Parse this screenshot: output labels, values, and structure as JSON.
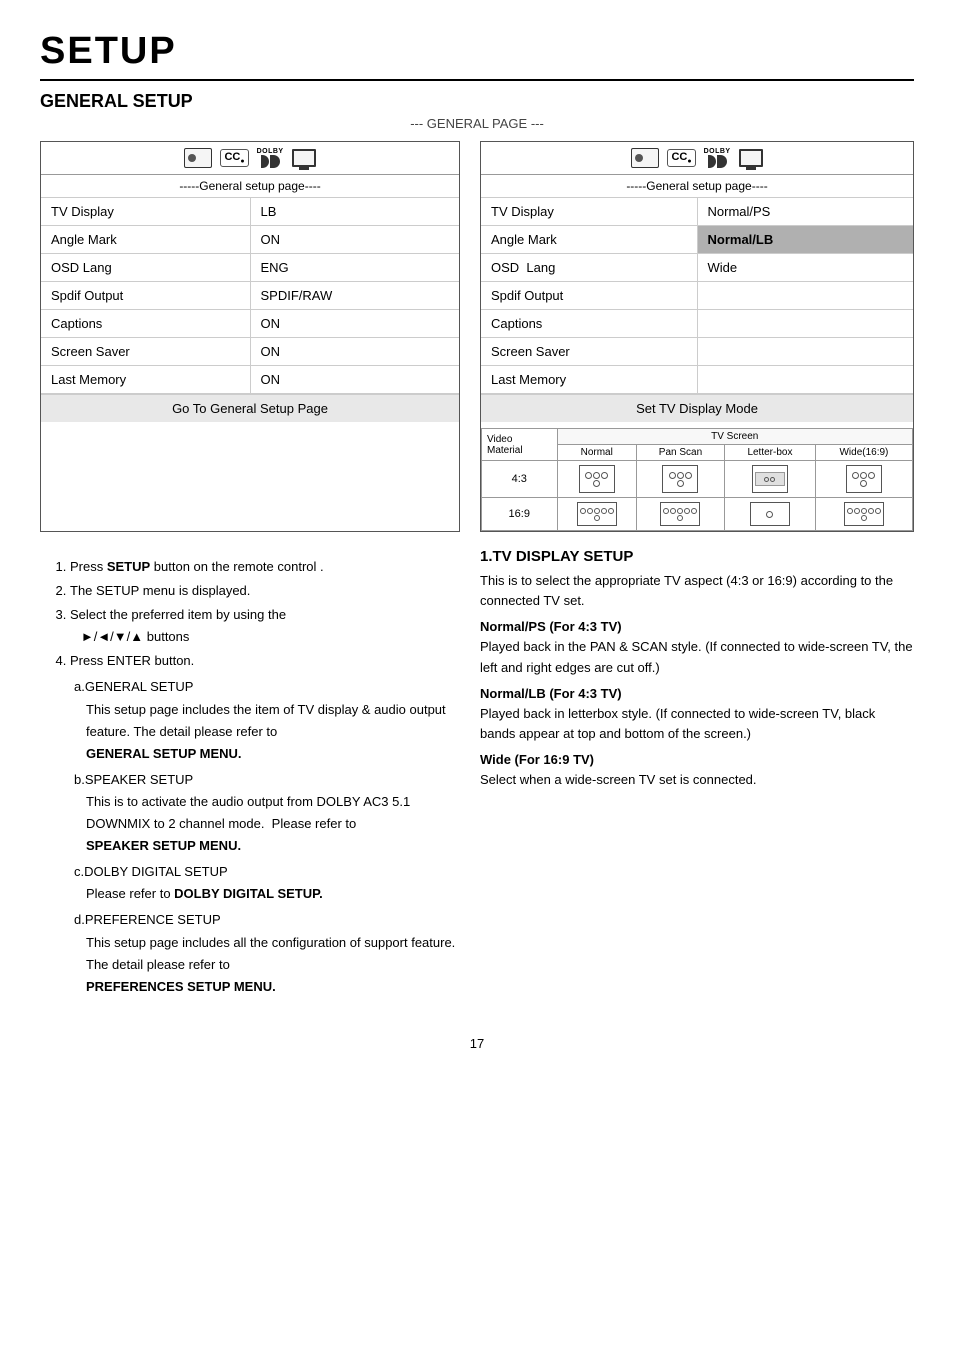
{
  "page": {
    "title": "SETUP",
    "section1_title": "GENERAL SETUP",
    "sub_heading": "--- GENERAL PAGE ---",
    "page_number": "17"
  },
  "panel_left": {
    "subtitle": "-----General setup page----",
    "rows": [
      {
        "label": "TV Display",
        "value": "LB"
      },
      {
        "label": "Angle Mark",
        "value": "ON"
      },
      {
        "label": "OSD Lang",
        "value": "ENG"
      },
      {
        "label": "Spdif Output",
        "value": "SPDIF/RAW"
      },
      {
        "label": "Captions",
        "value": "ON"
      },
      {
        "label": "Screen Saver",
        "value": "ON"
      },
      {
        "label": "Last Memory",
        "value": "ON"
      }
    ],
    "footer": "Go To General Setup Page"
  },
  "panel_right": {
    "subtitle": "-----General setup page----",
    "rows": [
      {
        "label": "TV Display",
        "value": "Normal/PS",
        "highlighted": false
      },
      {
        "label": "Angle Mark",
        "value": "Normal/LB",
        "highlighted": true
      },
      {
        "label": "OSD  Lang",
        "value": "Wide",
        "highlighted": false
      },
      {
        "label": "Spdif Output",
        "value": ""
      },
      {
        "label": "Captions",
        "value": ""
      },
      {
        "label": "Screen Saver",
        "value": ""
      },
      {
        "label": "Last Memory",
        "value": ""
      }
    ],
    "footer": "Set TV Display Mode"
  },
  "instructions": {
    "items": [
      "Press SETUP button on the remote control .",
      "The SETUP menu is displayed.",
      "Select the preferred item by using the ►/◄/▼/▲ buttons",
      "Press ENTER button.",
      "a. GENERAL SETUP\n        This setup page includes the item of TV display & audio output feature. The detail please refer to GENERAL SETUP MENU.",
      "b. SPEAKER SETUP\n        This is to activate the audio output from DOLBY AC3 5.1 DOWNMIX to 2 channel mode.  Please refer to SPEAKER SETUP MENU.",
      "c. DOLBY DIGITAL SETUP\n        Please refer to DOLBY DIGITAL SETUP.",
      "d. PREFERENCE SETUP\n        This setup page includes all the configuration of support feature. The detail please refer to PREFERENCES SETUP MENU."
    ]
  },
  "tv_display_table": {
    "header_top": "TV Screen",
    "col_labels": [
      "Video Material",
      "Normal",
      "Pan Scan",
      "Letter-box",
      "Wide(16:9)"
    ],
    "rows": [
      {
        "label": "4:3",
        "type": "circles"
      },
      {
        "label": "16:9",
        "type": "rectangles"
      }
    ]
  },
  "tv_display_section": {
    "title": "1.TV DISPLAY SETUP",
    "body": [
      "This is to select the appropriate TV aspect (4:3 or 16:9) according to the connected TV set.",
      "Normal/PS (For 4:3 TV)",
      "Played back in the PAN & SCAN style. (If connected to wide-screen TV, the left and right edges are cut off.)",
      "Normal/LB (For 4:3 TV)",
      "Played back in letterbox style. (If connected to wide-screen TV, black bands appear at top and bottom of the screen.)",
      "Wide (For 16:9 TV)",
      "Select when a wide-screen TV set is connected."
    ]
  }
}
